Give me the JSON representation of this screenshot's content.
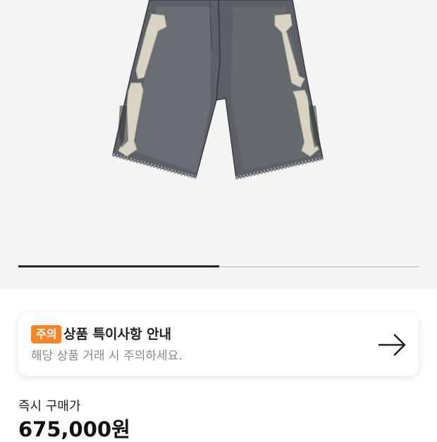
{
  "product": {
    "image_icon": "denim-shorts-bone-patch-image"
  },
  "gallery": {
    "progress": 0.5
  },
  "notice": {
    "badge": "주의",
    "title": "상품 특이사항 안내",
    "description": "해당 상품 거래 시 주의하세요.",
    "arrow_icon": "arrow-right-icon",
    "badge_color": "#f3862b"
  },
  "price": {
    "label": "즉시 구매가",
    "value": "675,000원"
  }
}
